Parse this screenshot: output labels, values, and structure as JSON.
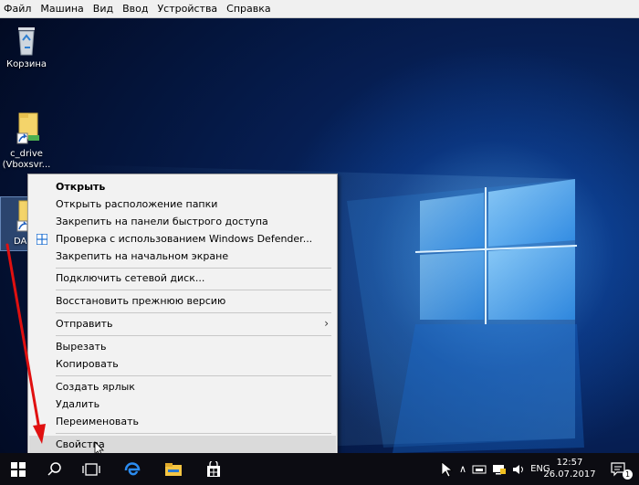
{
  "menubar": {
    "items": [
      "Файл",
      "Машина",
      "Вид",
      "Ввод",
      "Устройства",
      "Справка"
    ]
  },
  "desktop": {
    "icons": [
      {
        "label": "Корзина",
        "icon": "recycle-bin-icon"
      },
      {
        "label": "c_drive",
        "label2": "(Vboxsvr...",
        "icon": "shortcut-folder-icon"
      },
      {
        "label": "DA",
        "icon": "shortcut-folder-icon"
      }
    ]
  },
  "context_menu": {
    "items": [
      {
        "label": "Открыть",
        "bold": true
      },
      {
        "label": "Открыть расположение папки"
      },
      {
        "label": "Закрепить на панели быстрого доступа"
      },
      {
        "label": "Проверка с использованием Windows Defender...",
        "icon": "windows-defender-icon"
      },
      {
        "label": "Закрепить на начальном экране"
      },
      {
        "label": "Подключить сетевой диск..."
      },
      {
        "label": "Восстановить прежнюю версию"
      },
      {
        "label": "Отправить",
        "submenu": true
      },
      {
        "label": "Вырезать"
      },
      {
        "label": "Копировать"
      },
      {
        "label": "Создать ярлык"
      },
      {
        "label": "Удалить"
      },
      {
        "label": "Переименовать"
      },
      {
        "label": "Свойства",
        "hover": true
      }
    ]
  },
  "taskbar": {
    "language": "ENG",
    "time": "12:57",
    "date": "26.07.2017",
    "notification_count": "1"
  },
  "colors": {
    "accent_arrow": "#e01010",
    "taskbar": "#0c0c12",
    "menu_bg": "#f2f2f2"
  }
}
